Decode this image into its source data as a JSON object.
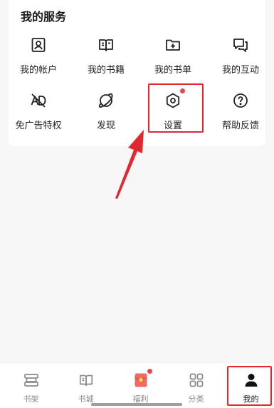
{
  "section": {
    "title": "我的服务",
    "items": [
      {
        "label": "我的帐户",
        "icon": "account-icon"
      },
      {
        "label": "我的书籍",
        "icon": "book-icon"
      },
      {
        "label": "我的书单",
        "icon": "folder-plus-icon"
      },
      {
        "label": "我的互动",
        "icon": "chat-icon"
      },
      {
        "label": "免广告特权",
        "icon": "ad-free-icon"
      },
      {
        "label": "发现",
        "icon": "planet-icon"
      },
      {
        "label": "设置",
        "icon": "settings-icon",
        "has_badge": true
      },
      {
        "label": "帮助反馈",
        "icon": "help-icon"
      }
    ]
  },
  "tabbar": {
    "items": [
      {
        "label": "书架",
        "icon": "bookshelf-icon"
      },
      {
        "label": "书城",
        "icon": "bookstore-icon"
      },
      {
        "label": "福利",
        "icon": "red-envelope-icon",
        "has_badge": true
      },
      {
        "label": "分类",
        "icon": "grid-icon"
      },
      {
        "label": "我的",
        "icon": "profile-icon",
        "active": true
      }
    ]
  },
  "colors": {
    "highlight": "#e0282e",
    "badge": "#e5484d",
    "envelope": "#f06a5f"
  }
}
